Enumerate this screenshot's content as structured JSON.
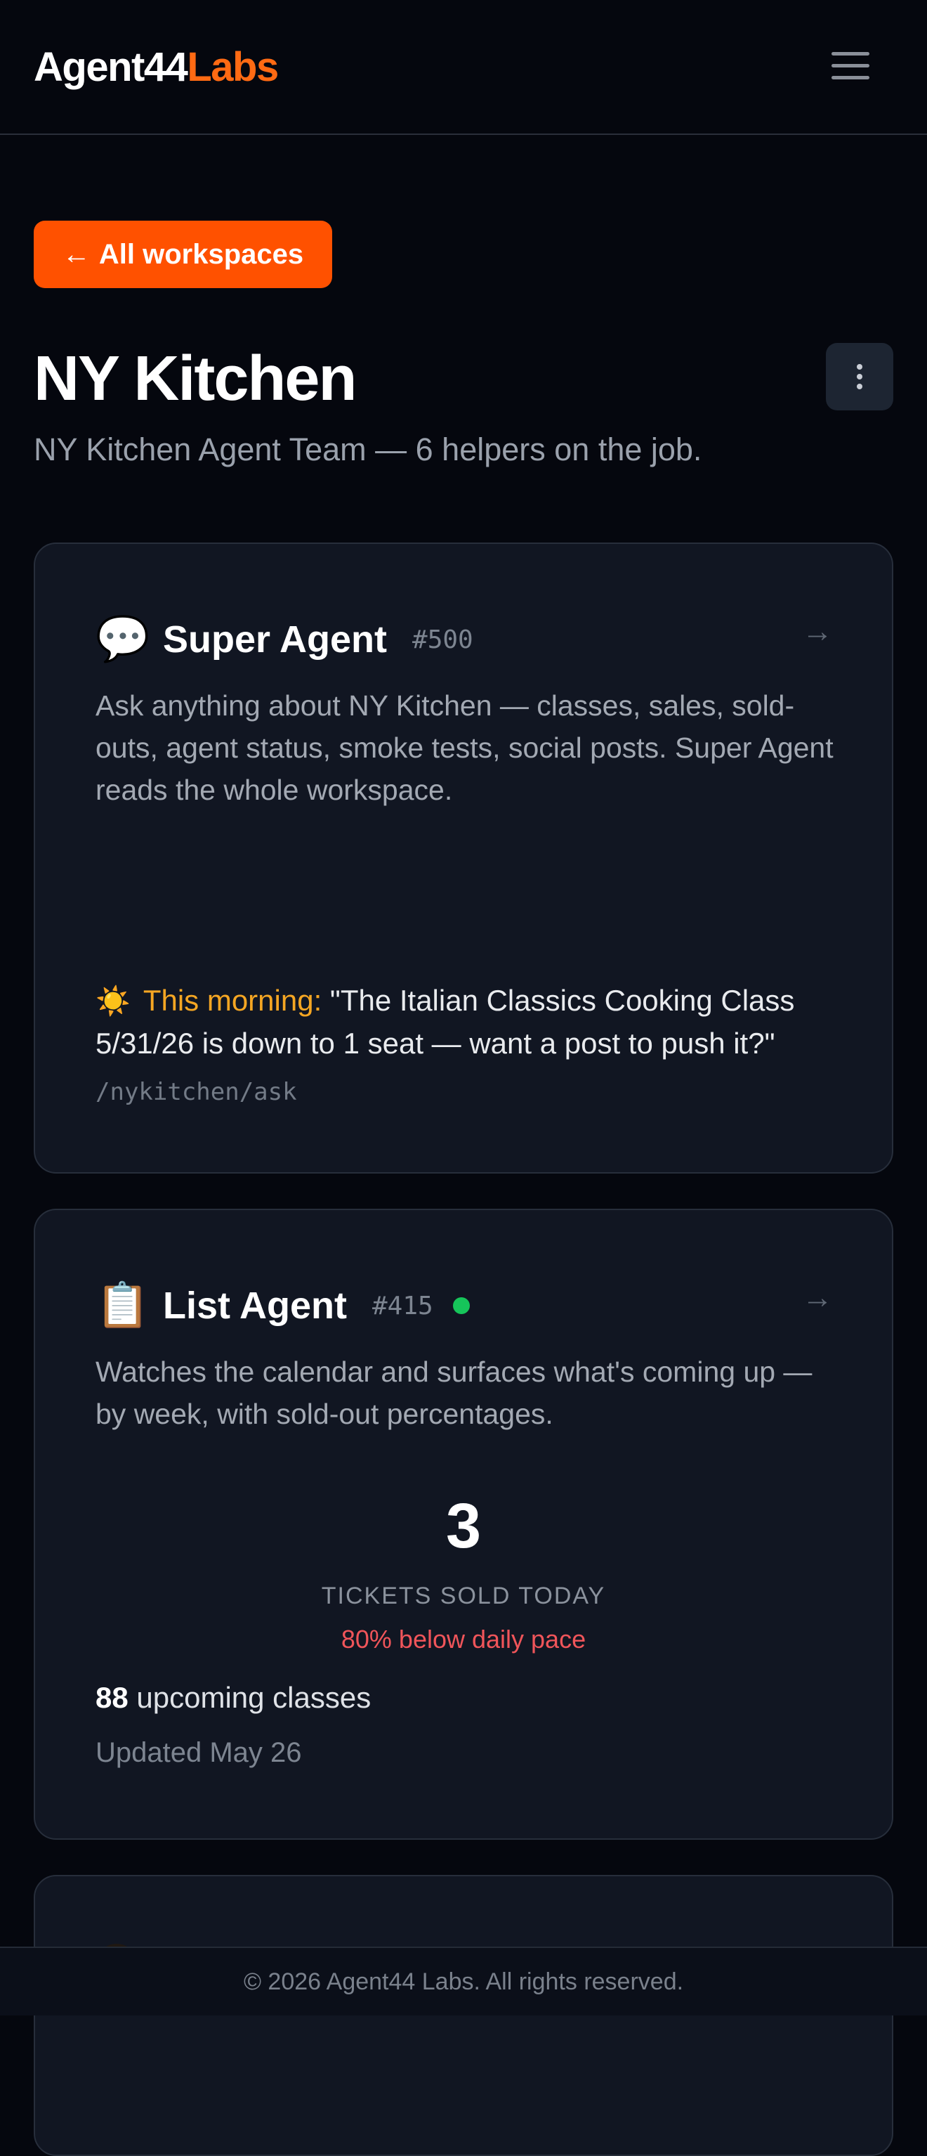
{
  "header": {
    "brand_primary": "Agent44",
    "brand_accent": "Labs",
    "menu_icon": "hamburger-menu-icon"
  },
  "nav": {
    "back_label": "All workspaces",
    "back_icon": "arrow-left-icon"
  },
  "workspace": {
    "title": "NY Kitchen",
    "subtitle": "NY Kitchen Agent Team — 6 helpers on the job.",
    "more_icon": "more-vertical-icon"
  },
  "agents": [
    {
      "emoji": "💬",
      "icon": "speech-bubble-icon",
      "name": "Super Agent",
      "id": "#500",
      "description": "Ask anything about NY Kitchen — classes, sales, sold-outs, agent status, smoke tests, social posts. Super Agent reads the whole workspace.",
      "morning_icon": "sun-icon",
      "morning_label": "This morning:",
      "morning_text": "\"The Italian Classics Cooking Class 5/31/26 is down to 1 seat — want a post to push it?\"",
      "path": "/nykitchen/ask"
    },
    {
      "emoji": "📋",
      "icon": "clipboard-icon",
      "name": "List Agent",
      "id": "#415",
      "status": "online",
      "description": "Watches the calendar and surfaces what's coming up — by week, with sold-out percentages.",
      "stat_value": "3",
      "stat_label": "TICKETS SOLD TODAY",
      "stat_alert": "80% below daily pace",
      "upcoming_count": "88",
      "upcoming_label": "upcoming classes",
      "updated": "Updated May 26"
    }
  ],
  "footer": {
    "text": "© 2026 Agent44 Labs. All rights reserved."
  },
  "colors": {
    "accent": "#ff5100",
    "brand_accent": "#ff6a13",
    "status_online": "#16c55a",
    "alert": "#f0555a",
    "morning_label": "#f5a623"
  }
}
